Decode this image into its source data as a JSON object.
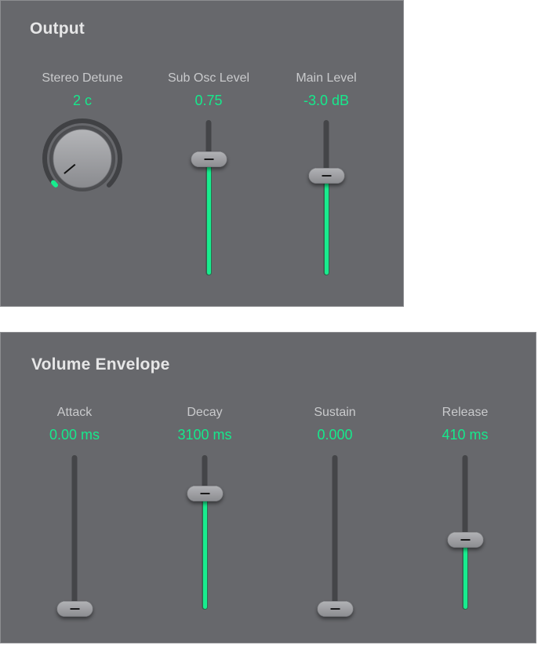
{
  "colors": {
    "panel_bg": "#67686c",
    "accent": "#18ec8e",
    "label": "#c9cacc",
    "title": "#e6e6e7",
    "track": "#444548"
  },
  "output": {
    "title": "Output",
    "stereo_detune": {
      "label": "Stereo Detune",
      "value": "2 c",
      "fraction": 0.02,
      "icon": "rotary-knob"
    },
    "sub_osc_level": {
      "label": "Sub Osc Level",
      "value": "0.75",
      "fraction": 0.75
    },
    "main_level": {
      "label": "Main Level",
      "value": "-3.0 dB",
      "fraction": 0.645
    }
  },
  "volume_envelope": {
    "title": "Volume Envelope",
    "sliders": [
      {
        "label": "Attack",
        "value": "0.00 ms",
        "fraction": 0.0
      },
      {
        "label": "Decay",
        "value": "3100 ms",
        "fraction": 0.755
      },
      {
        "label": "Sustain",
        "value": "0.000",
        "fraction": 0.0
      },
      {
        "label": "Release",
        "value": "410 ms",
        "fraction": 0.449
      }
    ]
  }
}
